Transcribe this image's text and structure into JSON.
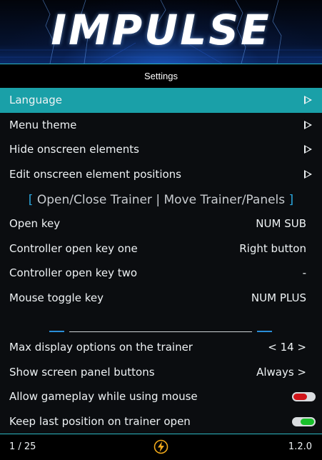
{
  "app": {
    "logo_text": "IMPULSE"
  },
  "header": {
    "title": "Settings"
  },
  "menu": {
    "items": [
      {
        "label": "Language",
        "selected": true
      },
      {
        "label": "Menu theme"
      },
      {
        "label": "Hide onscreen elements"
      },
      {
        "label": "Edit onscreen element positions"
      }
    ],
    "section": {
      "open_bracket": "[",
      "text": " Open/Close Trainer | Move Trainer/Panels ",
      "close_bracket": "]"
    },
    "keys": [
      {
        "label": "Open key",
        "value": "NUM SUB"
      },
      {
        "label": "Controller open key one",
        "value": "Right button"
      },
      {
        "label": "Controller open key two",
        "value": "-"
      },
      {
        "label": "Mouse toggle key",
        "value": "NUM PLUS"
      }
    ],
    "options": [
      {
        "label": "Max display options on the trainer",
        "value": "< 14 >"
      },
      {
        "label": "Show screen panel buttons",
        "value": "Always >"
      },
      {
        "label": "Allow gameplay while using mouse",
        "toggle": "off"
      },
      {
        "label": "Keep last position on trainer open",
        "toggle": "on"
      }
    ]
  },
  "footer": {
    "page": "1 / 25",
    "version": "1.2.0",
    "icon": "lightning-bolt-icon"
  },
  "colors": {
    "accent": "#1aa0a8",
    "bracket": "#2aa8e0",
    "toggle_off": "#d0141a",
    "toggle_on": "#19c02b"
  }
}
